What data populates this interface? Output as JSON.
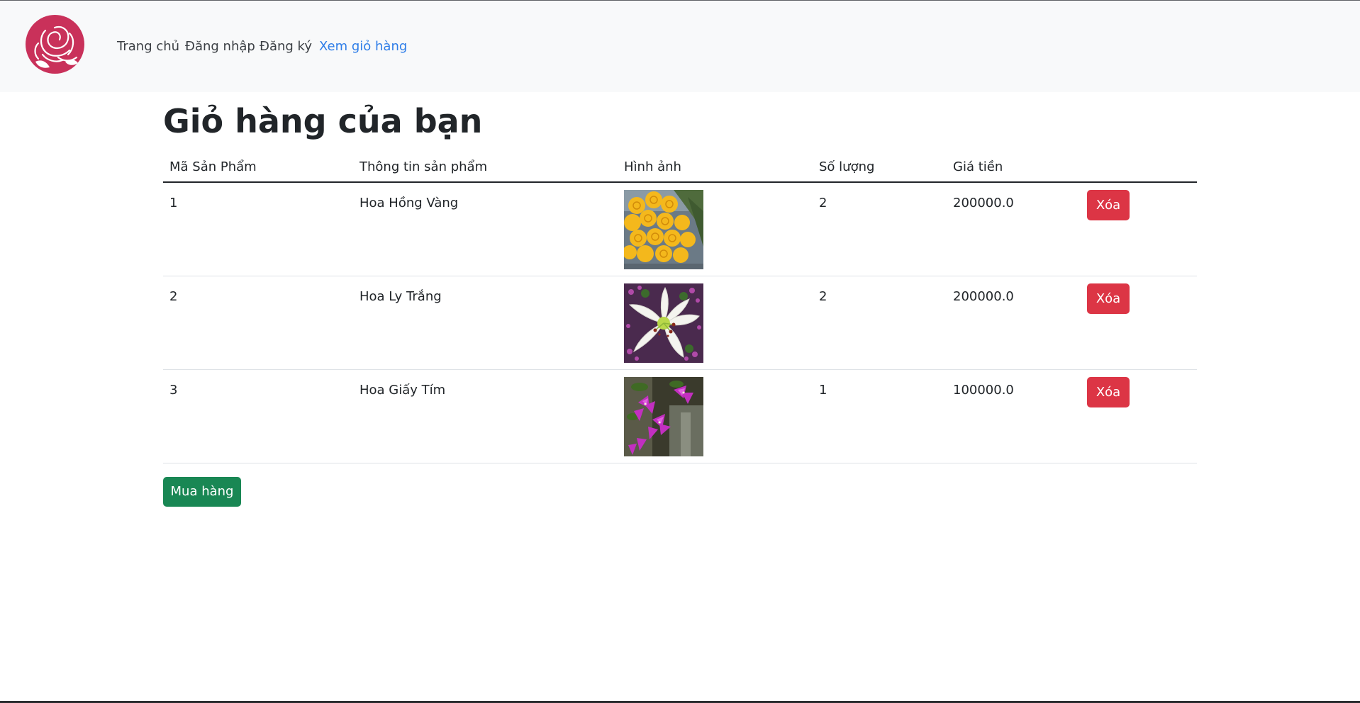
{
  "nav": {
    "items": [
      {
        "label": "Trang chủ",
        "active": false
      },
      {
        "label": "Đăng nhập",
        "active": false
      },
      {
        "label": "Đăng ký",
        "active": false
      },
      {
        "label": "Xem giỏ hàng",
        "active": true
      }
    ],
    "logo_icon": "rose-logo-icon"
  },
  "page": {
    "title": "Giỏ hàng của bạn"
  },
  "table": {
    "headers": [
      "Mã Sản Phẩm",
      "Thông tin sản phẩm",
      "Hình ảnh",
      "Số lượng",
      "Giá tiền",
      ""
    ],
    "rows": [
      {
        "id": "1",
        "name": "Hoa Hồng Vàng",
        "image": "yellow-roses-image",
        "qty": "2",
        "price": "200000.0",
        "action": "Xóa"
      },
      {
        "id": "2",
        "name": "Hoa Ly Trắng",
        "image": "white-lily-image",
        "qty": "2",
        "price": "200000.0",
        "action": "Xóa"
      },
      {
        "id": "3",
        "name": "Hoa Giấy Tím",
        "image": "purple-bougainvillea-image",
        "qty": "1",
        "price": "100000.0",
        "action": "Xóa"
      }
    ]
  },
  "buy_button": "Mua hàng",
  "colors": {
    "nav_bg": "#f8f9fa",
    "nav_active": "#2f7ee8",
    "danger": "#dc3545",
    "success": "#198754",
    "logo": "#c9315a"
  }
}
